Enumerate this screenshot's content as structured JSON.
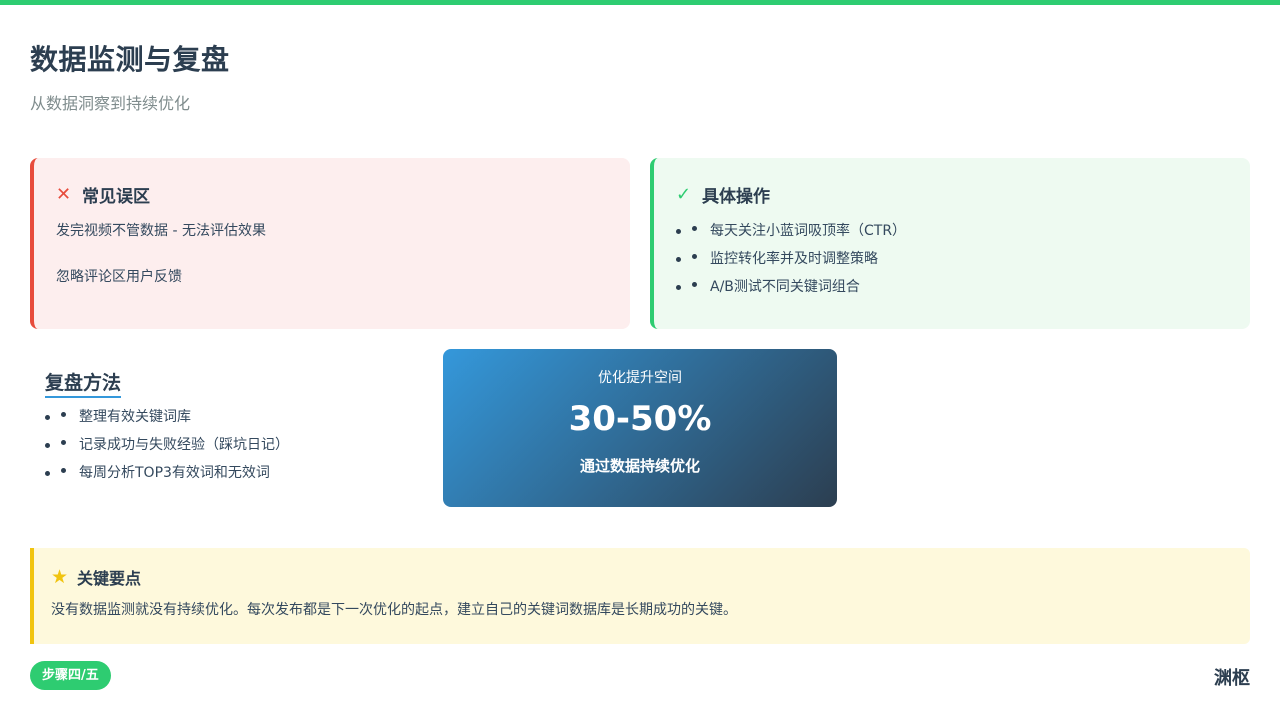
{
  "header": {
    "title": "数据监测与复盘",
    "subtitle": "从数据洞察到持续优化"
  },
  "mistakes": {
    "icon": "close-icon",
    "icon_glyph": "✕",
    "title": "常见误区",
    "items": [
      "发完视频不管数据 - 无法评估效果",
      "忽略评论区用户反馈"
    ]
  },
  "actions": {
    "icon": "check-icon",
    "icon_glyph": "✓",
    "title": "具体操作",
    "items": [
      "每天关注小蓝词吸顶率（CTR）",
      "监控转化率并及时调整策略",
      "A/B测试不同关键词组合"
    ]
  },
  "review": {
    "title": "复盘方法",
    "items": [
      "整理有效关键词库",
      "记录成功与失败经验（踩坑日记）",
      "每周分析TOP3有效词和无效词"
    ]
  },
  "metric": {
    "label": "优化提升空间",
    "value": "30-50%",
    "description": "通过数据持续优化"
  },
  "key_point": {
    "icon": "star-icon",
    "icon_glyph": "★",
    "title": "关键要点",
    "text": "没有数据监测就没有持续优化。每次发布都是下一次优化的起点，建立自己的关键词数据库是长期成功的关键。"
  },
  "footer": {
    "step": "步骤四/五",
    "brand": "渊枢"
  },
  "colors": {
    "accent_green": "#2ecc71",
    "accent_red": "#e74c3c",
    "accent_yellow": "#f1c40f",
    "accent_blue": "#3498db",
    "text_dark": "#2c3e50"
  }
}
